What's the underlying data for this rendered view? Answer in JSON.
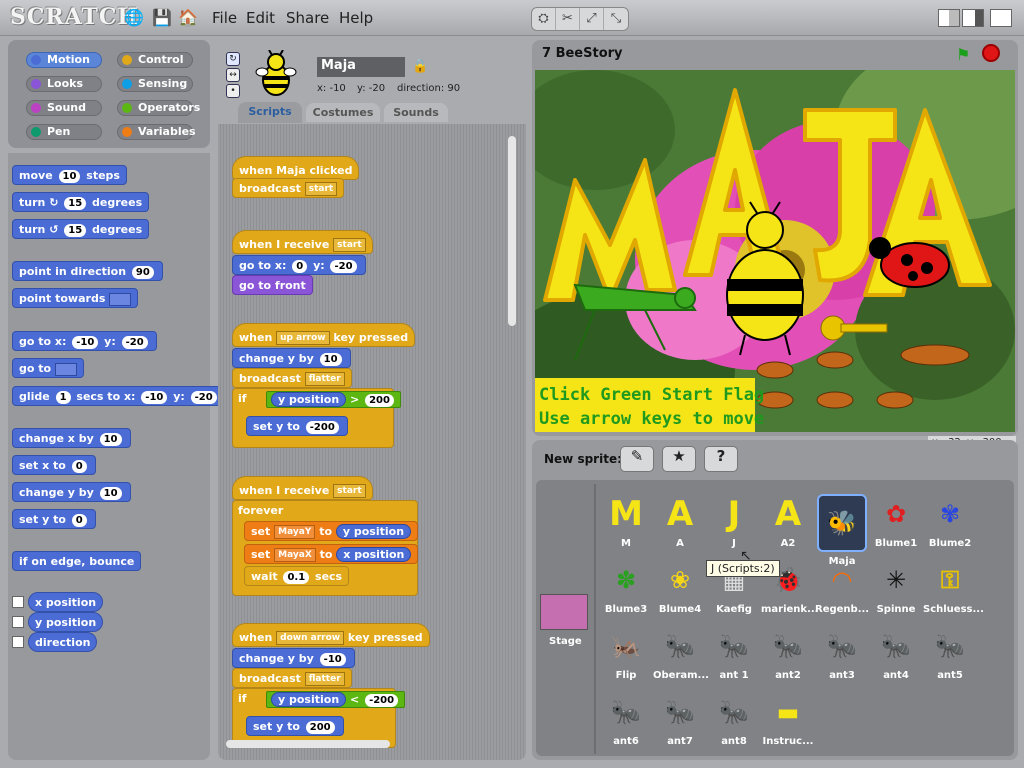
{
  "app": {
    "logo": "SCRATCH"
  },
  "menu": {
    "file": "File",
    "edit": "Edit",
    "share": "Share",
    "help": "Help"
  },
  "palette": {
    "categories": [
      {
        "label": "Motion",
        "color": "#4a6cd4"
      },
      {
        "label": "Control",
        "color": "#e1a91a"
      },
      {
        "label": "Looks",
        "color": "#8a55d7"
      },
      {
        "label": "Sensing",
        "color": "#0e9ee6"
      },
      {
        "label": "Sound",
        "color": "#bb42c3"
      },
      {
        "label": "Operators",
        "color": "#5cb712"
      },
      {
        "label": "Pen",
        "color": "#0e9a6c"
      },
      {
        "label": "Variables",
        "color": "#ee7d16"
      }
    ]
  },
  "blocks": {
    "move": "move",
    "move_val": "10",
    "move_suffix": "steps",
    "turn_r": "turn",
    "turn_r_val": "15",
    "turn_r_suffix": "degrees",
    "turn_l": "turn",
    "turn_l_val": "15",
    "turn_l_suffix": "degrees",
    "point_dir": "point in direction",
    "point_dir_val": "90",
    "point_towards": "point towards",
    "goto_xy": "go to x:",
    "goto_x": "-10",
    "goto_y_label": "y:",
    "goto_y": "-20",
    "goto": "go to",
    "glide": "glide",
    "glide_secs": "1",
    "glide_mid": "secs to x:",
    "glide_x": "-10",
    "glide_y_label": "y:",
    "glide_y": "-20",
    "change_x": "change x by",
    "change_x_val": "10",
    "set_x": "set x to",
    "set_x_val": "0",
    "change_y": "change y by",
    "change_y_val": "10",
    "set_y": "set y to",
    "set_y_val": "0",
    "bounce": "if on edge, bounce",
    "x_pos": "x position",
    "y_pos": "y position",
    "direction": "direction"
  },
  "sprite": {
    "name": "Maja",
    "x": "x: -10",
    "y": "y: -20",
    "direction": "direction: 90"
  },
  "tabs": {
    "scripts": "Scripts",
    "costumes": "Costumes",
    "sounds": "Sounds"
  },
  "scripts": {
    "s1_hat": "when Maja clicked",
    "s1_b1": "broadcast",
    "s1_b1_dd": "start",
    "s2_hat": "when I receive",
    "s2_hat_dd": "start",
    "s2_b1": "go to x:",
    "s2_b1_x": "0",
    "s2_b1_y_label": "y:",
    "s2_b1_y": "-20",
    "s2_b2": "go to front",
    "s3_hat": "when",
    "s3_hat_dd": "up arrow",
    "s3_hat_suffix": "key pressed",
    "s3_b1": "change y by",
    "s3_b1_val": "10",
    "s3_b2": "broadcast",
    "s3_b2_dd": "flatter",
    "s3_if": "if",
    "s3_if_rep": "y position",
    "s3_if_op": ">",
    "s3_if_val": "200",
    "s3_set": "set y to",
    "s3_set_val": "-200",
    "s4_hat": "when I receive",
    "s4_hat_dd": "start",
    "s4_forever": "forever",
    "s4_set1": "set",
    "s4_set1_dd": "MayaY",
    "s4_set1_to": "to",
    "s4_set1_rep": "y position",
    "s4_set2": "set",
    "s4_set2_dd": "MayaX",
    "s4_set2_to": "to",
    "s4_set2_rep": "x position",
    "s4_wait": "wait",
    "s4_wait_val": "0.1",
    "s4_wait_suffix": "secs",
    "s5_hat": "when",
    "s5_hat_dd": "down arrow",
    "s5_hat_suffix": "key pressed",
    "s5_b1": "change y by",
    "s5_b1_val": "-10",
    "s5_b2": "broadcast",
    "s5_b2_dd": "flatter",
    "s5_if": "if",
    "s5_if_rep": "y position",
    "s5_if_op": "<",
    "s5_if_val": "-200",
    "s5_set": "set y to",
    "s5_set_val": "200"
  },
  "stage": {
    "title": "7 BeeStory",
    "overlay_line1": "Click Green Start Flag",
    "overlay_line2": "Use arrow keys to move",
    "mouse_x": "x: -32",
    "mouse_y": "y: -300"
  },
  "new_sprite": {
    "label": "New sprite:"
  },
  "stage_thumb": {
    "label": "Stage"
  },
  "tooltip": "J (Scripts:2)",
  "sprites": [
    {
      "name": "M"
    },
    {
      "name": "A"
    },
    {
      "name": "J"
    },
    {
      "name": "A2"
    },
    {
      "name": "Maja"
    },
    {
      "name": "Blume1"
    },
    {
      "name": "Blume2"
    },
    {
      "name": "Blume3"
    },
    {
      "name": "Blume4"
    },
    {
      "name": "Kaefig"
    },
    {
      "name": "marienk..."
    },
    {
      "name": "Regenb..."
    },
    {
      "name": "Spinne"
    },
    {
      "name": "Schluess..."
    },
    {
      "name": "Flip"
    },
    {
      "name": "Oberam..."
    },
    {
      "name": "ant 1"
    },
    {
      "name": "ant2"
    },
    {
      "name": "ant3"
    },
    {
      "name": "ant4"
    },
    {
      "name": "ant5"
    },
    {
      "name": "ant6"
    },
    {
      "name": "ant7"
    },
    {
      "name": "ant8"
    },
    {
      "name": "Instruc..."
    }
  ]
}
